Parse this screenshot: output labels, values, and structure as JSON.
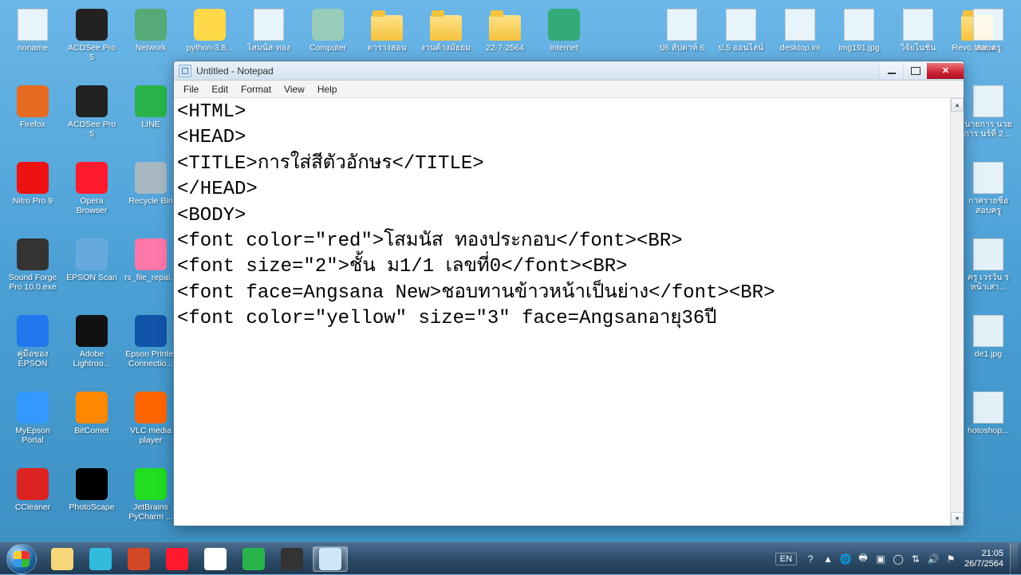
{
  "desktop": {
    "rows": [
      [
        {
          "label": "noname",
          "type": "generic"
        },
        {
          "label": "ACDSee Pro 5",
          "type": "app",
          "bg": "#222"
        },
        {
          "label": "Network",
          "type": "app",
          "bg": "#5a7"
        },
        {
          "label": "python-3.8...",
          "type": "app",
          "bg": "#ffd94a"
        },
        {
          "label": "โสมนัส-ทอง",
          "type": "generic"
        },
        {
          "label": "Computer",
          "type": "app",
          "bg": "#9cb"
        },
        {
          "label": "ตารางสอน",
          "type": "folder"
        },
        {
          "label": "งานต้างมัธยม",
          "type": "folder"
        },
        {
          "label": "22-7-2564",
          "type": "folder"
        },
        {
          "label": "Internet",
          "type": "app",
          "bg": "#3a7"
        },
        {
          "label": "",
          "type": "none"
        },
        {
          "label": "ป6 สัปดาห์ 6",
          "type": "generic"
        },
        {
          "label": "ป.5 ออนไลน์",
          "type": "generic"
        },
        {
          "label": "desktop.ini",
          "type": "generic"
        },
        {
          "label": "img191.jpg",
          "type": "generic"
        },
        {
          "label": "วิจัยในชั้น",
          "type": "generic"
        },
        {
          "label": "Revo.Unins...",
          "type": "folder"
        }
      ],
      [
        {
          "label": "Firefox",
          "type": "app",
          "bg": "#e66a1f"
        },
        {
          "label": "ACDSee Pro 5",
          "type": "app",
          "bg": "#222"
        },
        {
          "label": "LINE",
          "type": "app",
          "bg": "#28b44a"
        }
      ],
      [
        {
          "label": "Nitro Pro 9",
          "type": "app",
          "bg": "#e11"
        },
        {
          "label": "Opera Browser",
          "type": "app",
          "bg": "#ff1b2d"
        },
        {
          "label": "Recycle Bin",
          "type": "app",
          "bg": "#a7b8c2"
        }
      ],
      [
        {
          "label": "Sound Forge Pro 10.0.exe",
          "type": "app",
          "bg": "#333"
        },
        {
          "label": "EPSON Scan",
          "type": "app",
          "bg": "#6ad"
        },
        {
          "label": "rs_file_repai...",
          "type": "app",
          "bg": "#f7a"
        }
      ],
      [
        {
          "label": "คู่มือของ EPSON",
          "type": "app",
          "bg": "#27e"
        },
        {
          "label": "Adobe Lightroo...",
          "type": "app",
          "bg": "#111"
        },
        {
          "label": "Epson Printer Connectio...",
          "type": "app",
          "bg": "#15a"
        }
      ],
      [
        {
          "label": "MyEpson Portal",
          "type": "app",
          "bg": "#39f"
        },
        {
          "label": "BitComet",
          "type": "app",
          "bg": "#f80"
        },
        {
          "label": "VLC media player",
          "type": "app",
          "bg": "#f60"
        }
      ],
      [
        {
          "label": "CCleaner",
          "type": "app",
          "bg": "#d22"
        },
        {
          "label": "PhotoScape",
          "type": "app",
          "bg": "#000"
        },
        {
          "label": "JetBrains PyCharm ...",
          "type": "app",
          "bg": "#2d2"
        }
      ]
    ],
    "right": [
      {
        "label": "สอบครู"
      },
      {
        "label": "นายการ นวยการ นร์ที่ 2 ..."
      },
      {
        "label": "กาศรายชื่อ สอบครู"
      },
      {
        "label": "ครู เวรวัน ร หน้าเสา..."
      },
      {
        "label": "de1.jpg"
      },
      {
        "label": "hotoshop..."
      }
    ]
  },
  "notepad": {
    "title": "Untitled - Notepad",
    "menu": [
      "File",
      "Edit",
      "Format",
      "View",
      "Help"
    ],
    "content_lines": [
      "<HTML>",
      "<HEAD>",
      "<TITLE>การใส่สีตัวอักษร</TITLE>",
      "</HEAD>",
      "<BODY>",
      "<font color=\"red\">โสมนัส ทองประกอบ</font><BR>",
      "<font size=\"2\">ชั้น ม1/1 เลขที่0</font><BR>",
      "<font face=Angsana New>ชอบทานข้าวหน้าเป็นย่าง</font><BR>",
      "<font color=\"yellow\" size=\"3\" face=Angsanอายุ36ปี"
    ]
  },
  "taskbar": {
    "pinned": [
      {
        "name": "explorer",
        "bg": "#f7d67a"
      },
      {
        "name": "ie",
        "bg": "#3bd"
      },
      {
        "name": "powerpoint",
        "bg": "#d24726"
      },
      {
        "name": "opera",
        "bg": "#ff1b2d"
      },
      {
        "name": "chrome",
        "bg": "#fff"
      },
      {
        "name": "line",
        "bg": "#28b44a"
      },
      {
        "name": "obs",
        "bg": "#333"
      },
      {
        "name": "notepad",
        "bg": "#cde6fa",
        "active": true
      }
    ],
    "lang": "EN",
    "time": "21:05",
    "date": "26/7/2564",
    "tray": [
      "help",
      "up",
      "globe",
      "printer",
      "shield",
      "line",
      "net",
      "vol",
      "flag"
    ]
  }
}
